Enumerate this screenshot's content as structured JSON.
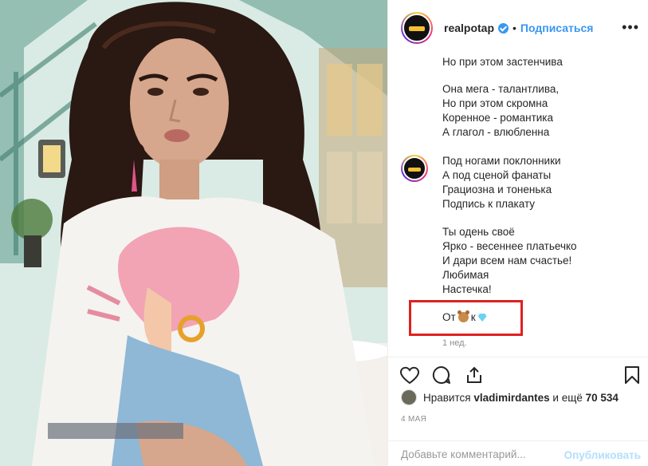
{
  "post": {
    "username": "realpotap",
    "follow_label": "Подписаться",
    "separator": "•",
    "more_label": "•••",
    "caption_block_1": [
      "Но при этом застенчива",
      "",
      "Она мега - талантлива,",
      "Но при этом скромна",
      "Коренное - романтика",
      "А глагол - влюбленна"
    ],
    "caption_block_2": [
      "Под ногами поклонники",
      "А под сценой фанаты",
      "Грациозна и тоненька",
      "Подпись к плакату",
      "",
      "Ты одень своё",
      "Ярко - весеннее платьечко",
      "И дари всем нам счастье!",
      "Любимая",
      "Настечка!"
    ],
    "signature_from": "От",
    "signature_to": "к",
    "time_ago": "1 нед.",
    "likes_prefix": "Нравится",
    "likes_user": "vladimirdantes",
    "likes_mid": "и ещё",
    "likes_count": "70 534",
    "date": "4 МАЯ",
    "comment_placeholder": "Добавьте комментарий...",
    "publish_label": "Опубликовать"
  },
  "colors": {
    "accent": "#3897f0",
    "highlight_box": "#e02020",
    "publish_disabled": "#b2dffc"
  },
  "icons": [
    "verified-badge-icon",
    "more-options-icon",
    "heart-icon",
    "comment-icon",
    "share-icon",
    "bookmark-icon",
    "bear-emoji-icon",
    "gem-emoji-icon"
  ]
}
